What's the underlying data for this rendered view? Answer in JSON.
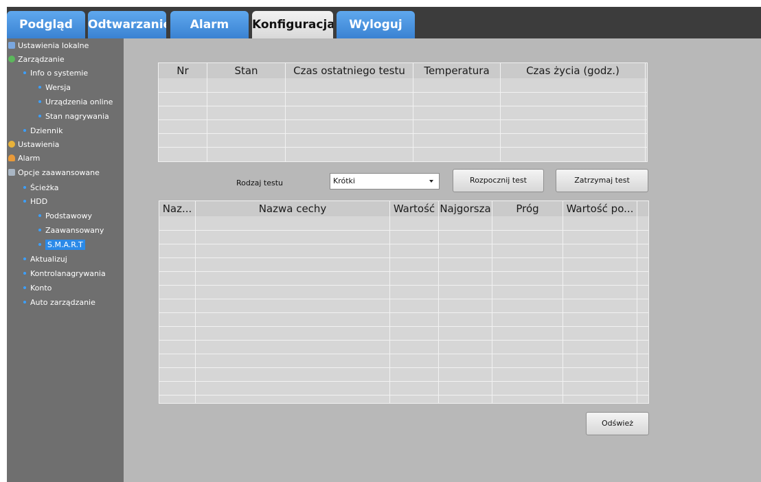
{
  "tabs": [
    {
      "label": "Podgląd"
    },
    {
      "label": "Odtwarzanie"
    },
    {
      "label": "Alarm"
    },
    {
      "label": "Konfiguracja"
    },
    {
      "label": "Wyloguj"
    }
  ],
  "active_tab": "Konfiguracja",
  "sidebar": {
    "items": [
      {
        "label": "Ustawienia lokalne",
        "level": 0,
        "icon": "monitor-icon"
      },
      {
        "label": "Zarządzanie",
        "level": 0,
        "icon": "info-icon"
      },
      {
        "label": "Info o systemie",
        "level": 1
      },
      {
        "label": "Wersja",
        "level": 2
      },
      {
        "label": "Urządzenia online",
        "level": 2
      },
      {
        "label": "Stan nagrywania",
        "level": 2
      },
      {
        "label": "Dziennik",
        "level": 1
      },
      {
        "label": "Ustawienia",
        "level": 0,
        "icon": "gear-icon"
      },
      {
        "label": "Alarm",
        "level": 0,
        "icon": "bell-icon"
      },
      {
        "label": "Opcje zaawansowane",
        "level": 0,
        "icon": "tools-icon"
      },
      {
        "label": "Ścieżka",
        "level": 1
      },
      {
        "label": "HDD",
        "level": 1
      },
      {
        "label": "Podstawowy",
        "level": 2
      },
      {
        "label": "Zaawansowany",
        "level": 2
      },
      {
        "label": "S.M.A.R.T",
        "level": 2,
        "selected": true
      },
      {
        "label": "Aktualizuj",
        "level": 1
      },
      {
        "label": "Kontrolanagrywania",
        "level": 1
      },
      {
        "label": "Konto",
        "level": 1
      },
      {
        "label": "Auto zarządzanie",
        "level": 1
      }
    ]
  },
  "test_table": {
    "columns": [
      "Nr",
      "Stan",
      "Czas ostatniego testu",
      "Temperatura",
      "Czas życia (godz.)"
    ]
  },
  "test_controls": {
    "test_type_label": "Rodzaj testu",
    "test_type_value": "Krótki",
    "start_button": "Rozpocznij test",
    "stop_button": "Zatrzymaj test"
  },
  "smart_table": {
    "columns": [
      "Naz...",
      "Nazwa cechy",
      "Wartość",
      "Najgorsza",
      "Próg",
      "Wartość po..."
    ]
  },
  "refresh_button": "Odśwież",
  "colors": {
    "tab_blue": "#4a94e0",
    "tab_active": "#e6e6e6",
    "topbar": "#3c3c3c",
    "sidebar": "#6f6f6f",
    "content": "#b8b8b8",
    "selection": "#2b8ae8"
  }
}
